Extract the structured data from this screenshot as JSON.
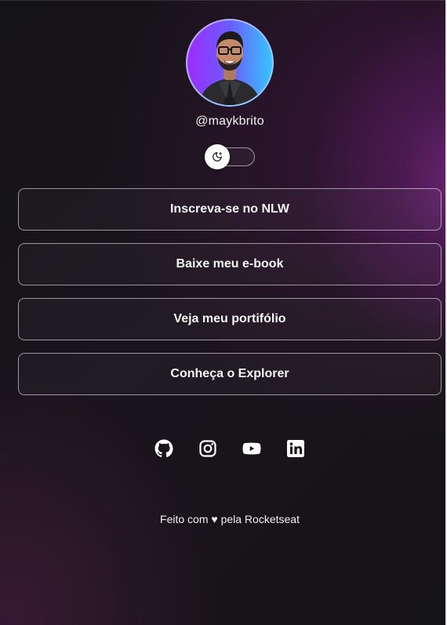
{
  "profile": {
    "handle": "@maykbrito",
    "avatar_alt": "Mayk Brito"
  },
  "theme_switch": {
    "icon": "moon-icon",
    "state": "dark"
  },
  "links": [
    {
      "label": "Inscreva-se no NLW"
    },
    {
      "label": "Baixe meu e-book"
    },
    {
      "label": "Veja meu portifólio"
    },
    {
      "label": "Conheça o Explorer"
    }
  ],
  "social": [
    {
      "icon": "github-icon"
    },
    {
      "icon": "instagram-icon"
    },
    {
      "icon": "youtube-icon"
    },
    {
      "icon": "linkedin-icon"
    }
  ],
  "footer": {
    "text": "Feito com ♥ pela Rocketseat"
  },
  "colors": {
    "text": "#f4f4f5",
    "avatar_gradient_start": "#9b2dfc",
    "avatar_gradient_end": "#39c4ff",
    "glow": "#7a2a84"
  }
}
